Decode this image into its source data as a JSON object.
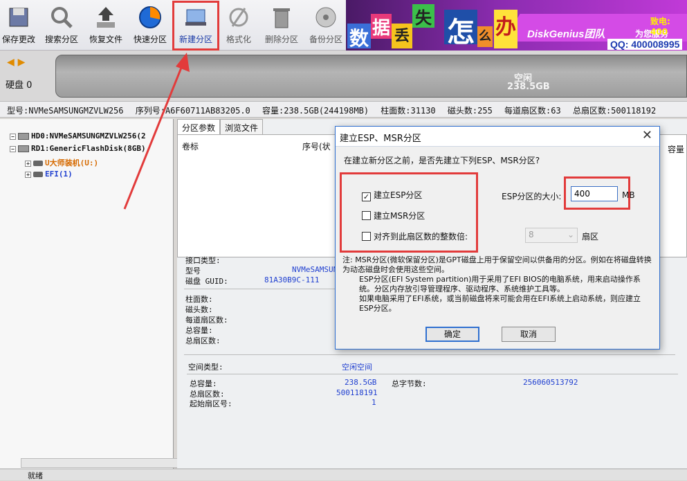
{
  "toolbar": {
    "buttons": [
      {
        "label": "保存更改",
        "icon": "save-icon"
      },
      {
        "label": "搜索分区",
        "icon": "search-icon"
      },
      {
        "label": "恢复文件",
        "icon": "recover-icon"
      },
      {
        "label": "快速分区",
        "icon": "quick-partition-icon"
      },
      {
        "label": "新建分区",
        "icon": "new-partition-icon"
      },
      {
        "label": "格式化",
        "icon": "format-icon"
      },
      {
        "label": "删除分区",
        "icon": "delete-icon"
      },
      {
        "label": "备份分区",
        "icon": "backup-icon"
      }
    ]
  },
  "banner": {
    "tiles": [
      "数",
      "据",
      "丢",
      "失",
      "怎",
      "么",
      "办"
    ],
    "slogan_en": "DiskGenius团队",
    "slogan_cn": "为您服务",
    "phone": "致电: 400",
    "qq": "QQ: 400008995"
  },
  "diskmap": {
    "disk_label": "硬盘 0",
    "free_label": "空闲",
    "free_size": "238.5GB"
  },
  "infobar": {
    "model": "型号:NVMeSAMSUNGMZVLW256",
    "serial": "序列号:A6F60711AB83205.0",
    "capacity": "容量:238.5GB(244198MB)",
    "cylinders": "柱面数:31130",
    "heads": "磁头数:255",
    "sectors_per_track": "每道扇区数:63",
    "total_sectors": "总扇区数:500118192"
  },
  "tree": {
    "hd0": "HD0:NVMeSAMSUNGMZVLW256(2",
    "rd1": "RD1:GenericFlashDisk(8GB)",
    "part1": "U大师装机(U:)",
    "part2": "EFI(1)"
  },
  "panel": {
    "tab1": "分区参数",
    "tab2": "浏览文件",
    "col_label": "卷标",
    "col_index": "序号(状",
    "col_capacity": "容量",
    "iface_label": "接口类型:",
    "model_label": "型号",
    "model_value": "NVMeSAMSUN",
    "guid_label": "磁盘 GUID:",
    "guid_value": "81A30B9C-111",
    "cyl_label": "柱面数:",
    "heads_label": "磁头数:",
    "spt_label": "每道扇区数:",
    "cap_label": "总容量:",
    "sectors_label": "总扇区数:",
    "space_type_label": "空间类型:",
    "space_type_value": "空闲空间",
    "total_cap_label": "总容量:",
    "total_cap_value": "238.5GB",
    "total_bytes_label": "总字节数:",
    "total_bytes_value": "256060513792",
    "total_sectors_label": "总扇区数:",
    "total_sectors_value": "500118191",
    "start_sector_label": "起始扇区号:",
    "start_sector_value": "1"
  },
  "dialog": {
    "title": "建立ESP、MSR分区",
    "question": "在建立新分区之前，是否先建立下列ESP、MSR分区?",
    "esp_checkbox": "建立ESP分区",
    "esp_checked": true,
    "msr_checkbox": "建立MSR分区",
    "msr_checked": false,
    "align_checkbox": "对齐到此扇区数的整数倍:",
    "align_checked": false,
    "esp_size_label": "ESP分区的大小:",
    "esp_size_value": "400",
    "esp_size_unit": "MB",
    "align_value": "8",
    "align_unit": "扇区",
    "note1": "注: MSR分区(微软保留分区)是GPT磁盘上用于保留空间以供备用的分区。例如在将磁盘转换为动态磁盘时会使用这些空间。",
    "note2": "ESP分区(EFI System partition)用于采用了EFI BIOS的电脑系统，用来启动操作系统。分区内存放引导管理程序、驱动程序、系统维护工具等。",
    "note3": "如果电脑采用了EFI系统，或当前磁盘将来可能会用在EFI系统上启动系统，则应建立ESP分区。",
    "ok": "确定",
    "cancel": "取消"
  },
  "status": "就绪",
  "colors": {
    "highlight": "#e23b3b",
    "accent": "#2e6fd0"
  }
}
